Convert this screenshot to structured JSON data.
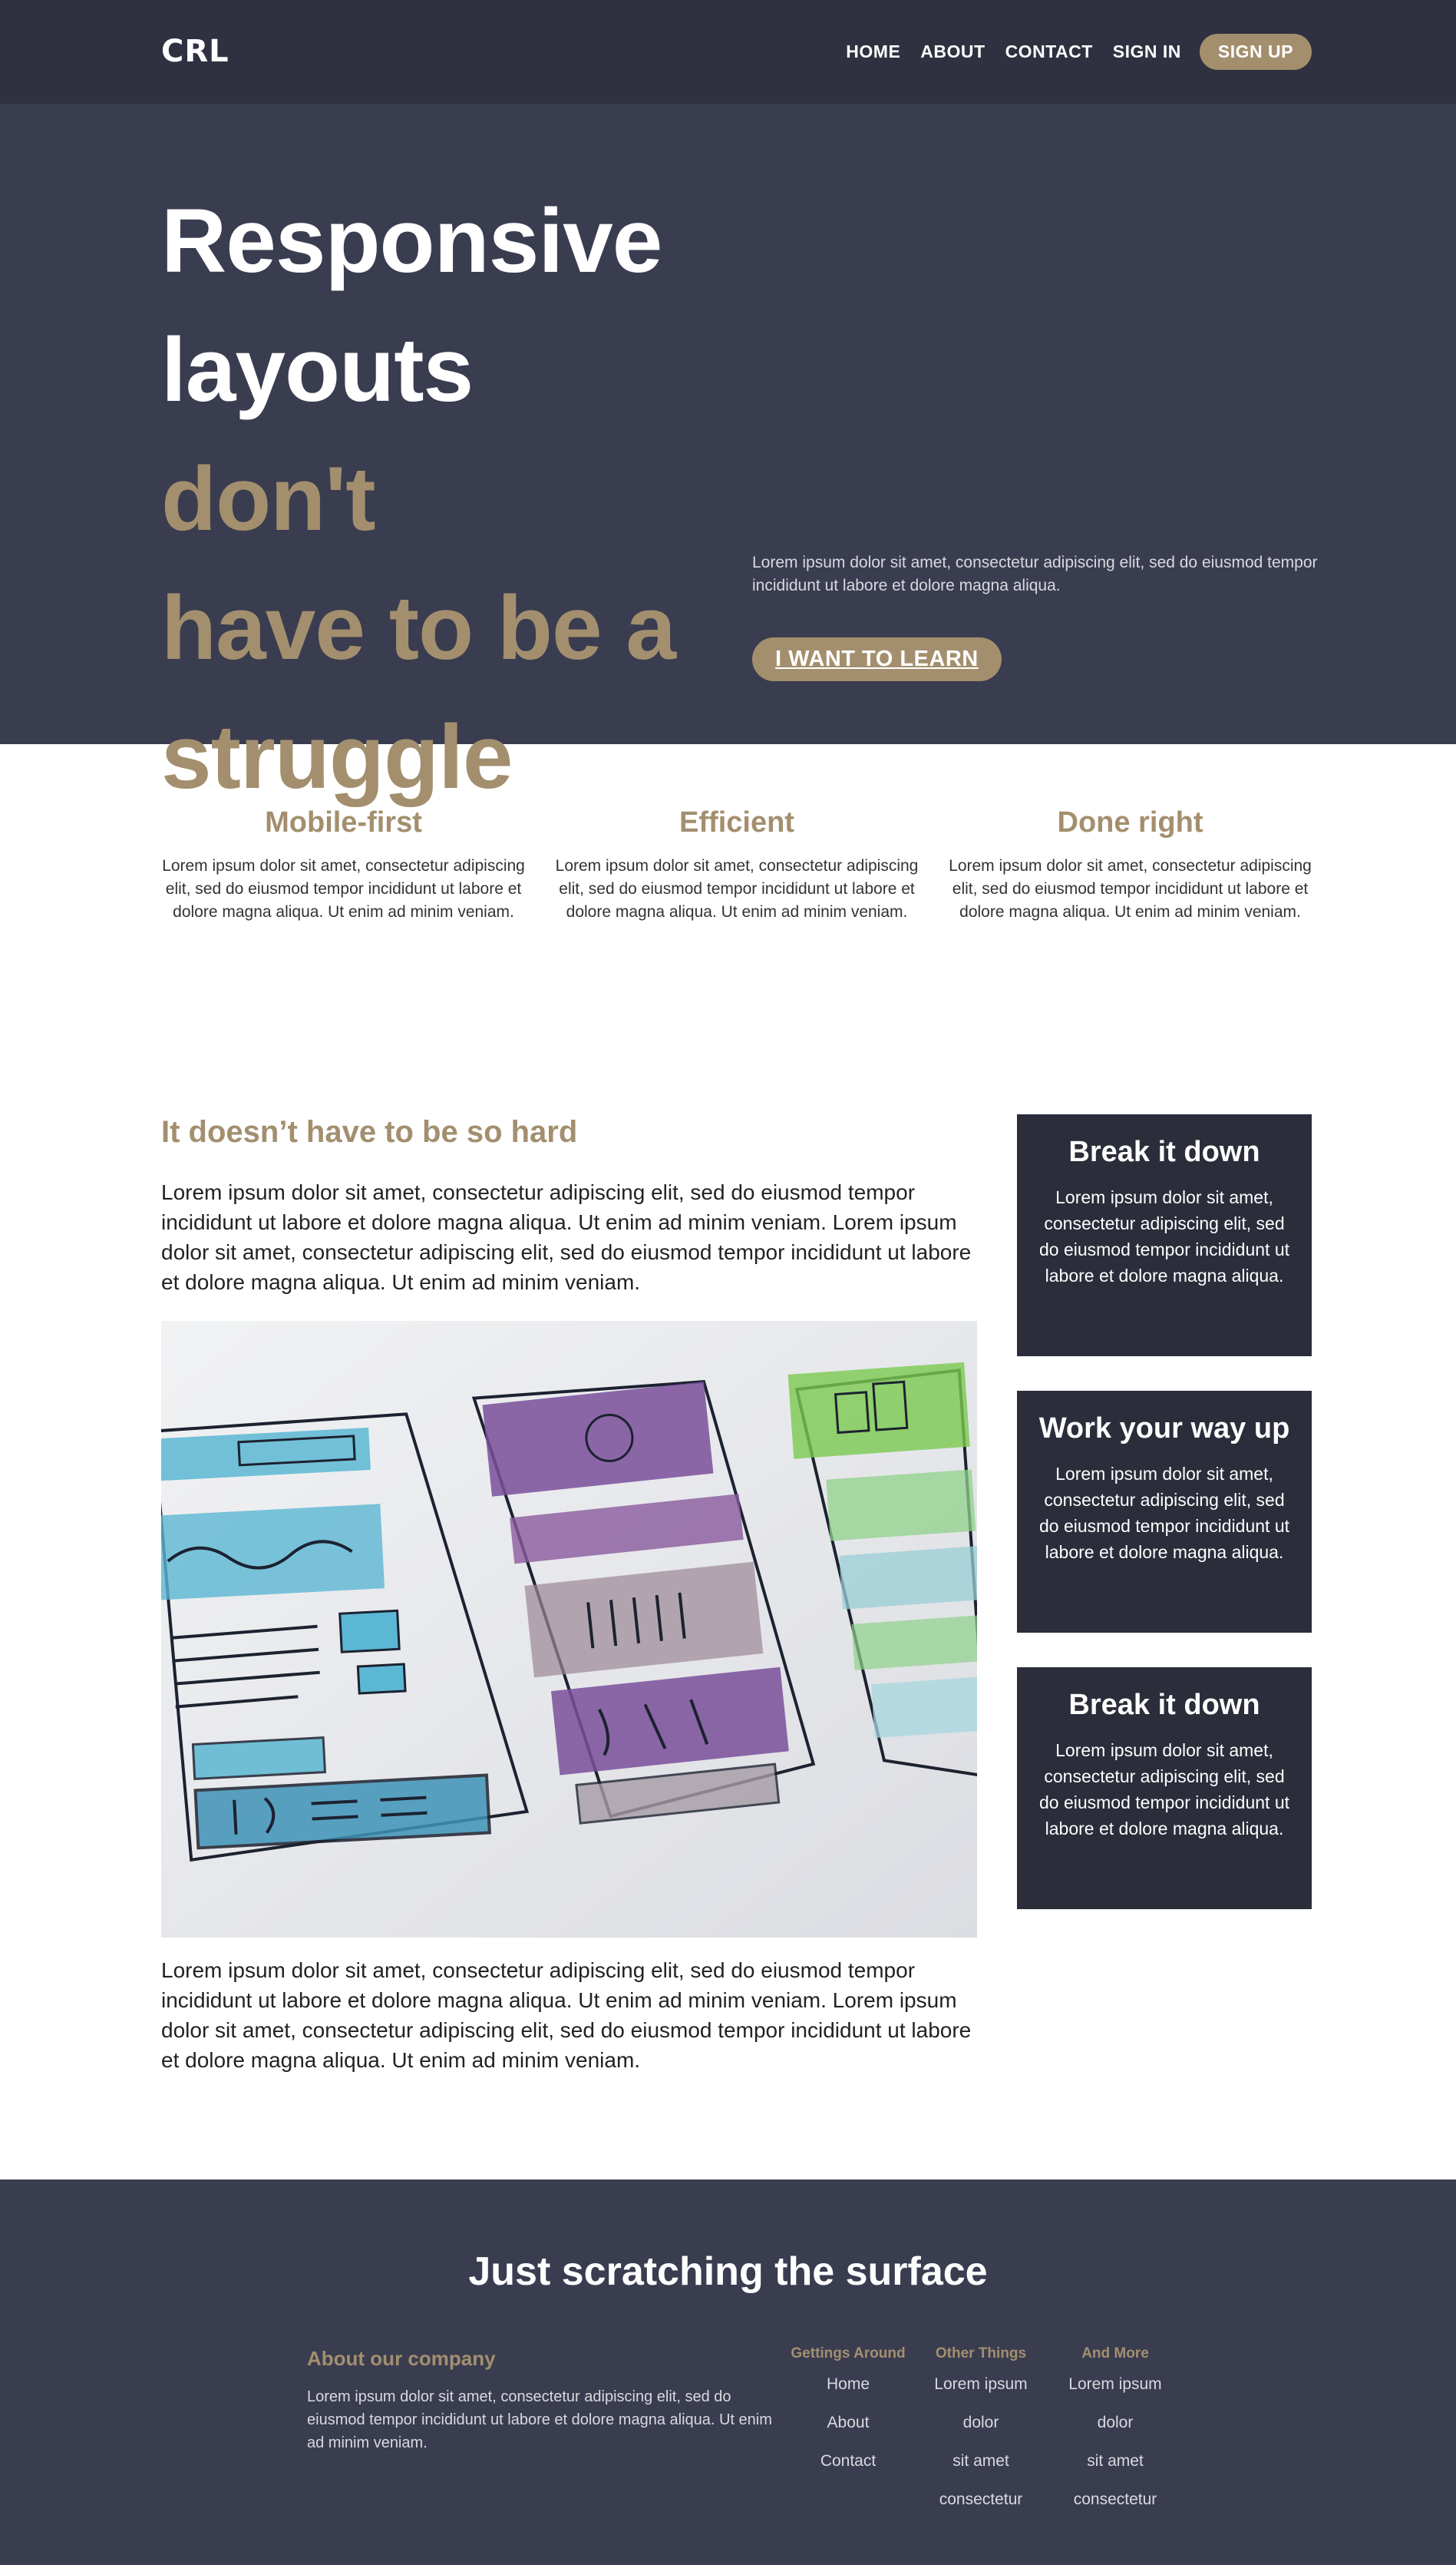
{
  "header": {
    "logo": "CRL",
    "nav": [
      "HOME",
      "ABOUT",
      "CONTACT",
      "SIGN IN"
    ],
    "signup": "SIGN UP"
  },
  "hero": {
    "title_white_1": "Responsive",
    "title_white_2": "layouts",
    "title_accent_1": "don't",
    "title_accent_2": "have to be a",
    "title_accent_3": "struggle",
    "text": "Lorem ipsum dolor sit amet, consectetur adipiscing elit, sed do eiusmod tempor incididunt ut labore et dolore magna aliqua.",
    "button": "I WANT TO LEARN"
  },
  "features": [
    {
      "title": "Mobile-first",
      "text": "Lorem ipsum dolor sit amet, consectetur adipiscing elit, sed do eiusmod tempor incididunt ut labore et dolore magna aliqua. Ut enim ad minim veniam."
    },
    {
      "title": "Efficient",
      "text": "Lorem ipsum dolor sit amet, consectetur adipiscing elit, sed do eiusmod tempor incididunt ut labore et dolore magna aliqua. Ut enim ad minim veniam."
    },
    {
      "title": "Done right",
      "text": "Lorem ipsum dolor sit amet, consectetur adipiscing elit, sed do eiusmod tempor incididunt ut labore et dolore magna aliqua. Ut enim ad minim veniam."
    }
  ],
  "main": {
    "heading": "It doesn’t have to be so hard",
    "para1": "Lorem ipsum dolor sit amet, consectetur adipiscing elit, sed do eiusmod tempor incididunt ut labore et dolore magna aliqua. Ut enim ad minim veniam. Lorem ipsum dolor sit amet, consectetur adipiscing elit, sed do eiusmod tempor incididunt ut labore et dolore magna aliqua. Ut enim ad minim veniam.",
    "para2": "Lorem ipsum dolor sit amet, consectetur adipiscing elit, sed do eiusmod tempor incididunt ut labore et dolore magna aliqua. Ut enim ad minim veniam. Lorem ipsum dolor sit amet, consectetur adipiscing elit, sed do eiusmod tempor incididunt ut labore et dolore magna aliqua. Ut enim ad minim veniam."
  },
  "aside": [
    {
      "title": "Break it down",
      "text": "Lorem ipsum dolor sit amet, consectetur adipiscing elit, sed do eiusmod tempor incididunt ut labore et dolore magna aliqua."
    },
    {
      "title": "Work your way up",
      "text": "Lorem ipsum dolor sit amet, consectetur adipiscing elit, sed do eiusmod tempor incididunt ut labore et dolore magna aliqua."
    },
    {
      "title": "Break it down",
      "text": "Lorem ipsum dolor sit amet, consectetur adipiscing elit, sed do eiusmod tempor incididunt ut labore et dolore magna aliqua."
    }
  ],
  "footer": {
    "title": "Just scratching the surface",
    "about_title": "About our company",
    "about_text": "Lorem ipsum dolor sit amet, consectetur adipiscing elit, sed do eiusmod tempor incididunt ut labore et dolore magna aliqua. Ut enim ad minim veniam.",
    "columns": [
      {
        "title": "Gettings Around",
        "items": [
          "Home",
          "About",
          "Contact"
        ]
      },
      {
        "title": "Other Things",
        "items": [
          "Lorem ipsum",
          "dolor",
          "sit amet",
          "consectetur"
        ]
      },
      {
        "title": "And More",
        "items": [
          "Lorem ipsum",
          "dolor",
          "sit amet",
          "consectetur"
        ]
      }
    ]
  },
  "colors": {
    "header_bg": "#2f3140",
    "hero_bg": "#3a3d50",
    "accent": "#a38f6e",
    "card_bg": "#2b2d3a"
  }
}
